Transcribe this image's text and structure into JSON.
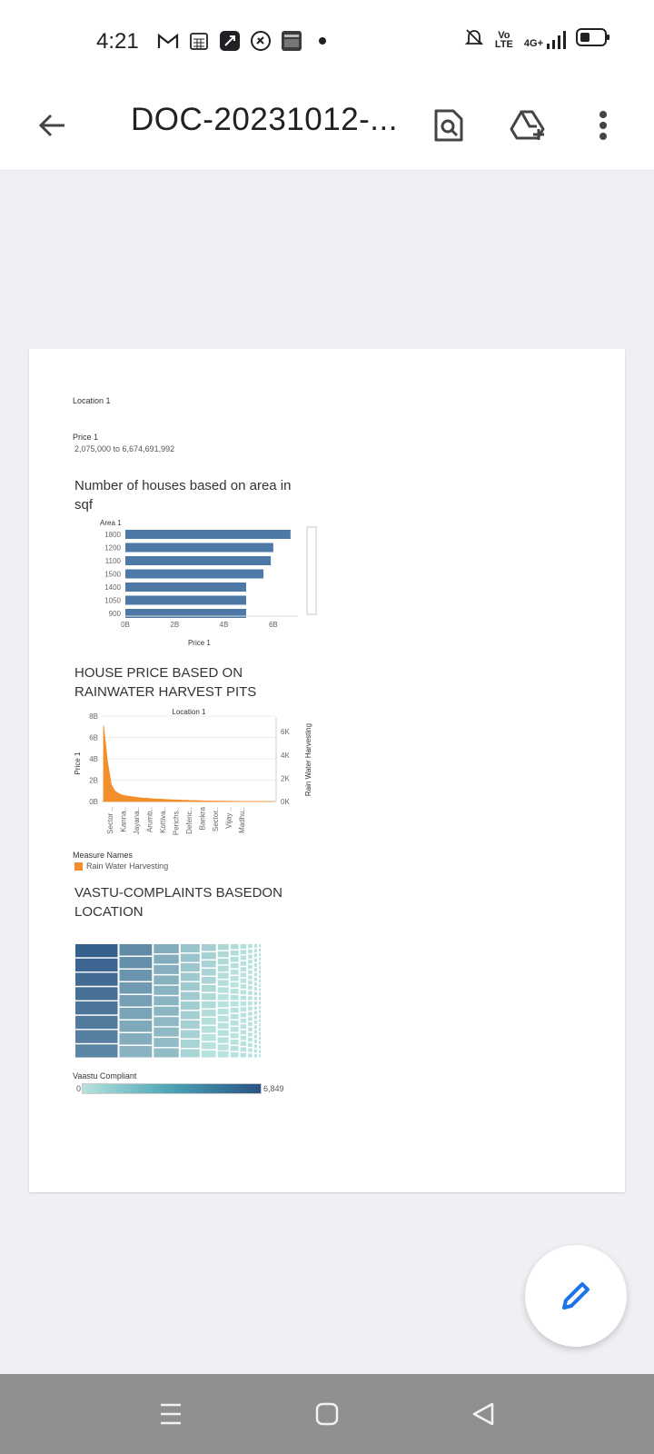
{
  "status_bar": {
    "time": "4:21",
    "left_icons": [
      "gmail-icon",
      "calendar-icon",
      "app-icon",
      "shazam-icon",
      "news-icon",
      "dot-icon"
    ],
    "right_icons": [
      "mute-icon",
      "volte-icon",
      "4g-signal-icon",
      "battery-icon"
    ],
    "volte_label": "Vo LTE",
    "network_label": "4G+"
  },
  "app_bar": {
    "title": "DOC-20231012-...",
    "back_icon": "arrow-left-icon",
    "actions": [
      "find-in-page-icon",
      "drive-add-icon",
      "more-vert-icon"
    ]
  },
  "document": {
    "filters": {
      "location_label": "Location 1",
      "price_label": "Price 1",
      "price_range": "2,075,000 to 6,674,691,992"
    },
    "chart1_title": "Number of houses based on area in sqf",
    "chart2_title": "HOUSE PRICE BASED ON RAINWATER HARVEST PITS",
    "chart3_title": "VASTU-COMPLAINTS BASEDON LOCATION",
    "legend2": {
      "heading": "Measure Names",
      "item": "Rain Water Harvesting"
    },
    "legend3": {
      "heading": "Vaastu Compliant",
      "min": "0",
      "max": "6,849"
    }
  },
  "chart_data": [
    {
      "type": "bar",
      "orientation": "horizontal",
      "title": "Number of houses based on area in sqf",
      "ylabel": "Area 1",
      "xlabel": "Price 1",
      "categories": [
        "1800",
        "1200",
        "1100",
        "1500",
        "1400",
        "1050",
        "900"
      ],
      "values": [
        6.7,
        6.0,
        5.9,
        5.6,
        4.9,
        4.9,
        4.9
      ],
      "value_unit": "B",
      "x_ticks": [
        "0B",
        "2B",
        "4B",
        "6B"
      ],
      "xlim": [
        0,
        7
      ],
      "color": "#4e79a7"
    },
    {
      "type": "area",
      "title": "HOUSE PRICE BASED ON RAINWATER HARVEST PITS",
      "top_label": "Location 1",
      "ylabel": "Price 1",
      "ylabel_right": "Rain Water Harvesting",
      "y_ticks": [
        "0B",
        "2B",
        "4B",
        "6B",
        "8B"
      ],
      "y_right_ticks": [
        "0K",
        "2K",
        "4K",
        "6K"
      ],
      "ylim_right": [
        0,
        7000
      ],
      "x_tick_labels": [
        "Sector ..",
        "Kanna..",
        "Jayana..",
        "Arumb..",
        "Kottiva..",
        "Perichs..",
        "Defenc..",
        "Bankra",
        "Sector..",
        "Vijay ..",
        "Madhu.."
      ],
      "series": [
        {
          "name": "Rain Water Harvesting",
          "values": [
            6800,
            3600,
            1500,
            900,
            700,
            550,
            500,
            450,
            400,
            350,
            320,
            300,
            260,
            240,
            220,
            200,
            180,
            160,
            150,
            140,
            120,
            110,
            100,
            90,
            80,
            70,
            60,
            50,
            40,
            40,
            30,
            30,
            20,
            20,
            20,
            10,
            10,
            10,
            10,
            5,
            5,
            5,
            0,
            0,
            0
          ],
          "color": "#f28e2b"
        }
      ]
    },
    {
      "type": "heatmap",
      "title": "VASTU-COMPLAINTS BASEDON LOCATION",
      "color_legend": "Vaastu Compliant",
      "color_range": [
        0,
        6849
      ],
      "color_low": "#b7e2de",
      "color_high": "#2a5385",
      "columns": [
        {
          "cells": 8,
          "value": 6200
        },
        {
          "cells": 9,
          "value": 4200
        },
        {
          "cells": 11,
          "value": 2600
        },
        {
          "cells": 12,
          "value": 1500
        },
        {
          "cells": 14,
          "value": 900
        },
        {
          "cells": 16,
          "value": 550
        },
        {
          "cells": 18,
          "value": 350
        },
        {
          "cells": 20,
          "value": 220
        },
        {
          "cells": 22,
          "value": 130
        },
        {
          "cells": 24,
          "value": 70
        },
        {
          "cells": 26,
          "value": 30
        }
      ]
    }
  ],
  "fab": {
    "icon": "edit-pencil-icon",
    "color": "#1a73e8"
  },
  "nav_bar": {
    "icons": [
      "recent-apps-icon",
      "home-icon",
      "back-nav-icon"
    ]
  }
}
